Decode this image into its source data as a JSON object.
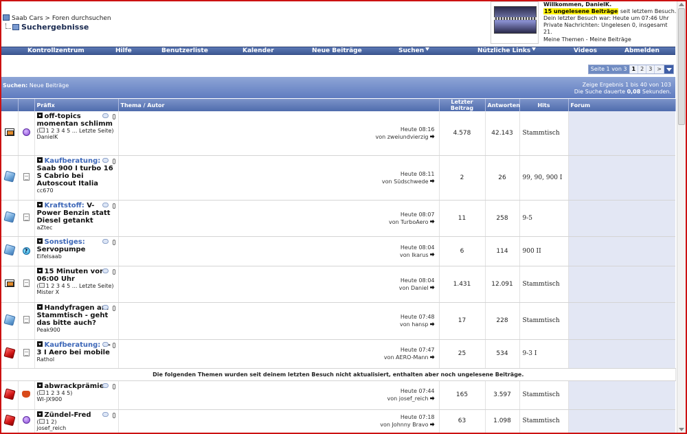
{
  "breadcrumb": {
    "site": "Saab Cars",
    "separator": ">",
    "section": "Foren durchsuchen",
    "page_title": "Suchergebnisse"
  },
  "welcome": {
    "greeting": "Willkommen, DanielK.",
    "unread_highlight": "15 ungelesene Beiträge",
    "unread_suffix": "seit letztem Besuch.",
    "last_visit": "Dein letzter Besuch war: Heute um 07:46 Uhr",
    "pm": "Private Nachrichten: Ungelesen 0, insgesamt 21.",
    "links": "Meine Themen - Meine Beiträge"
  },
  "nav": [
    "Kontrollzentrum",
    "Hilfe",
    "Benutzerliste",
    "Kalender",
    "Neue Beiträge",
    "Suchen",
    "Nützliche Links",
    "Videos",
    "Abmelden"
  ],
  "pager": {
    "label": "Seite 1 von 3",
    "pages": [
      "1",
      "2",
      "3"
    ],
    "current": "1",
    "next": ">"
  },
  "results": {
    "label": "Suchen:",
    "value": "Neue Beiträge",
    "range": "Zeige Ergebnis 1 bis 40 von 103",
    "duration_prefix": "Die Suche dauerte",
    "duration": "0,08",
    "duration_suffix": "Sekunden."
  },
  "columns": {
    "prefix": "Präfix",
    "topic": "Thema / Autor",
    "last": "Letzter Beitrag",
    "replies": "Antworten",
    "hits": "Hits",
    "forum": "Forum"
  },
  "separator_text": "Die folgenden Themen wurden seit deinem letzten Besuch nicht aktualisiert, enthalten aber noch ungelesene Beiträge.",
  "rows": [
    {
      "icon1": "mail-icon",
      "icon2": "smiley-icon",
      "prefix": "",
      "title": "off-topics momentan schlimm",
      "pages": "1 2 3 4 5 ... Letzte Seite)",
      "author": "DanielK",
      "time": "Heute 08:16",
      "by": "von zweiundvierzig",
      "replies": "4.578",
      "hits": "42.143",
      "forum": "Stammtisch"
    },
    {
      "icon1": "blue-folder-icon",
      "icon2": "document-icon",
      "prefix": "Kaufberatung:",
      "title": "Saab 900 I turbo 16 S Cabrio bei Autoscout Italia",
      "pages": "",
      "author": "cc670",
      "time": "Heute 08:11",
      "by": "von Südschwede",
      "replies": "2",
      "hits": "26",
      "forum": "99, 90, 900 I"
    },
    {
      "icon1": "blue-folder-icon",
      "icon2": "document-icon",
      "prefix": "Kraftstoff:",
      "title": "V-Power Benzin statt Diesel getankt",
      "pages": "",
      "author": "aZtec",
      "time": "Heute 08:07",
      "by": "von TurboAero",
      "replies": "11",
      "hits": "258",
      "forum": "9-5"
    },
    {
      "icon1": "blue-folder-icon",
      "icon2": "question-icon",
      "prefix": "Sonstiges:",
      "title": "Servopumpe",
      "pages": "",
      "author": "Eifelsaab",
      "time": "Heute 08:04",
      "by": "von Ikarus",
      "replies": "6",
      "hits": "114",
      "forum": "900 II"
    },
    {
      "icon1": "mail-icon",
      "icon2": "document-icon",
      "prefix": "",
      "title": "15 Minuten vor 06:00 Uhr",
      "pages": "1 2 3 4 5 ... Letzte Seite)",
      "author": "Mister X",
      "time": "Heute 08:04",
      "by": "von Daniel",
      "replies": "1.431",
      "hits": "12.091",
      "forum": "Stammtisch"
    },
    {
      "icon1": "blue-folder-icon",
      "icon2": "document-icon",
      "prefix": "",
      "title": "Handyfragen am Stammtisch - geht das bitte auch?",
      "pages": "",
      "author": "Peak900",
      "time": "Heute 07:48",
      "by": "von hansp",
      "replies": "17",
      "hits": "228",
      "forum": "Stammtisch"
    },
    {
      "icon1": "red-folder-icon",
      "icon2": "document-icon",
      "prefix": "Kaufberatung:",
      "title": "9-3 I Aero bei mobile",
      "pages": "",
      "author": "Rathol",
      "time": "Heute 07:47",
      "by": "von AERO-Mann",
      "replies": "25",
      "hits": "534",
      "forum": "9-3 I"
    }
  ],
  "rows_old": [
    {
      "icon1": "red-folder-icon",
      "icon2": "thumbs-down-icon",
      "prefix": "",
      "title": "abwrackprämie",
      "pages": "1 2 3 4 5)",
      "author": "WI-JX900",
      "time": "Heute 07:44",
      "by": "von josef_reich",
      "replies": "165",
      "hits": "3.597",
      "forum": "Stammtisch"
    },
    {
      "icon1": "red-folder-icon",
      "icon2": "smiley-icon",
      "prefix": "",
      "title": "Zündel-Fred",
      "pages": "1 2)",
      "author": "josef_reich",
      "time": "Heute 07:18",
      "by": "von Johnny Bravo",
      "replies": "63",
      "hits": "1.098",
      "forum": "Stammtisch"
    }
  ]
}
